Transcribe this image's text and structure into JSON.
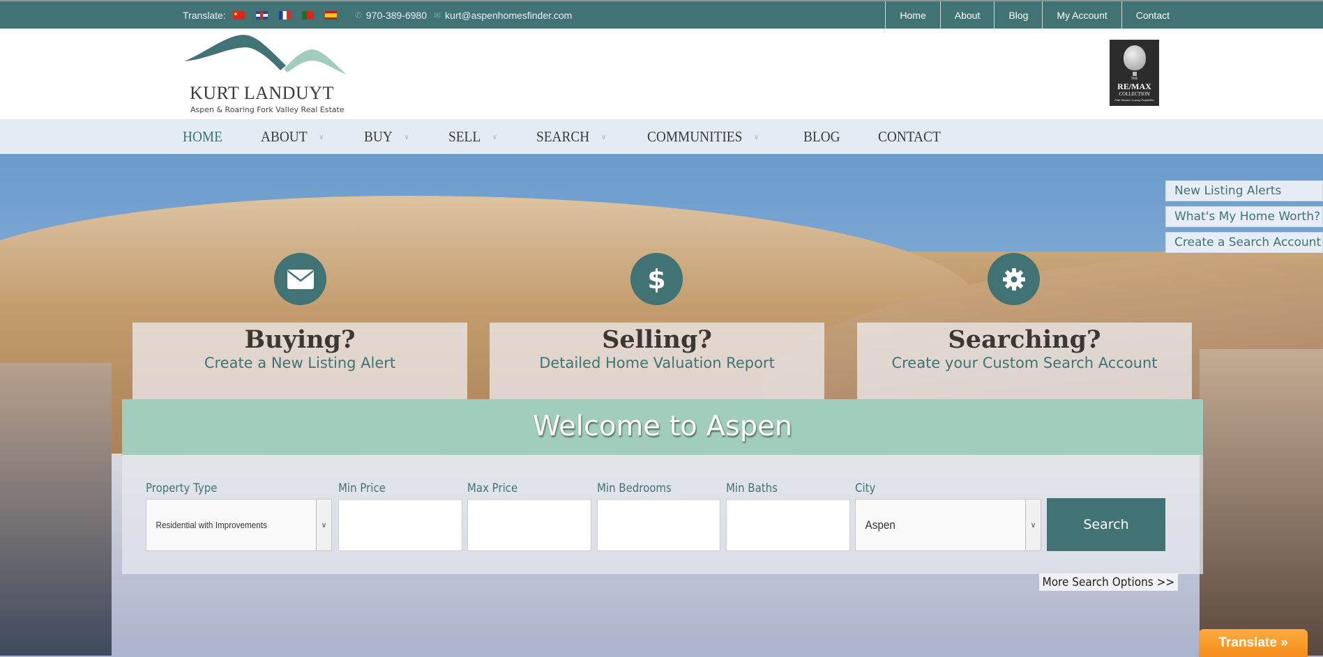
{
  "topbar": {
    "translate_label": "Translate:",
    "flags": [
      {
        "name": "chinese-flag-icon",
        "lang": "Chinese"
      },
      {
        "name": "english-flag-icon",
        "lang": "English"
      },
      {
        "name": "french-flag-icon",
        "lang": "French"
      },
      {
        "name": "portuguese-flag-icon",
        "lang": "Portuguese"
      },
      {
        "name": "spanish-flag-icon",
        "lang": "Spanish"
      }
    ],
    "phone": "970-389-6980",
    "email": "kurt@aspenhomesfinder.com",
    "nav": [
      "Home",
      "About",
      "Blog",
      "My Account",
      "Contact"
    ]
  },
  "header": {
    "logo_name": "KURT LANDUYT",
    "logo_tagline": "Aspen & Roaring Fork Valley Real Estate",
    "remax": {
      "line1": "THE",
      "line2": "RE/MAX",
      "line3": "COLLECTION",
      "line4": "Fine Homes / Luxury Properties"
    }
  },
  "mainnav": {
    "items": [
      {
        "label": "HOME",
        "dropdown": false,
        "active": true
      },
      {
        "label": "ABOUT",
        "dropdown": true
      },
      {
        "label": "BUY",
        "dropdown": true
      },
      {
        "label": "SELL",
        "dropdown": true
      },
      {
        "label": "SEARCH",
        "dropdown": true
      },
      {
        "label": "COMMUNITIES",
        "dropdown": true
      },
      {
        "label": "BLOG",
        "dropdown": false
      },
      {
        "label": "CONTACT",
        "dropdown": false
      }
    ],
    "chevron": "∨"
  },
  "sidetabs": [
    "New Listing Alerts",
    "What's My Home Worth?",
    "Create a Search Account"
  ],
  "features": [
    {
      "icon": "envelope-icon",
      "title": "Buying?",
      "subtitle": "Create a New Listing Alert"
    },
    {
      "icon": "dollar-icon",
      "title": "Selling?",
      "subtitle": "Detailed Home Valuation Report"
    },
    {
      "icon": "gear-icon",
      "title": "Searching?",
      "subtitle": "Create your Custom Search Account"
    }
  ],
  "search": {
    "heading": "Welcome to Aspen",
    "fields": {
      "property_type": {
        "label": "Property Type",
        "value": "Residential with Improvements"
      },
      "min_price": {
        "label": "Min Price",
        "value": ""
      },
      "max_price": {
        "label": "Max Price",
        "value": ""
      },
      "min_bedrooms": {
        "label": "Min Bedrooms",
        "value": ""
      },
      "min_baths": {
        "label": "Min Baths",
        "value": ""
      },
      "city": {
        "label": "City",
        "value": "Aspen"
      }
    },
    "button": "Search",
    "more_options": "More Search Options >>"
  },
  "translate_button": "Translate »",
  "colors": {
    "brand_teal": "#417274",
    "welcome_mint": "#a1cdbc",
    "nav_bg": "#e3ebf3",
    "translate_orange": "#f7a032"
  }
}
